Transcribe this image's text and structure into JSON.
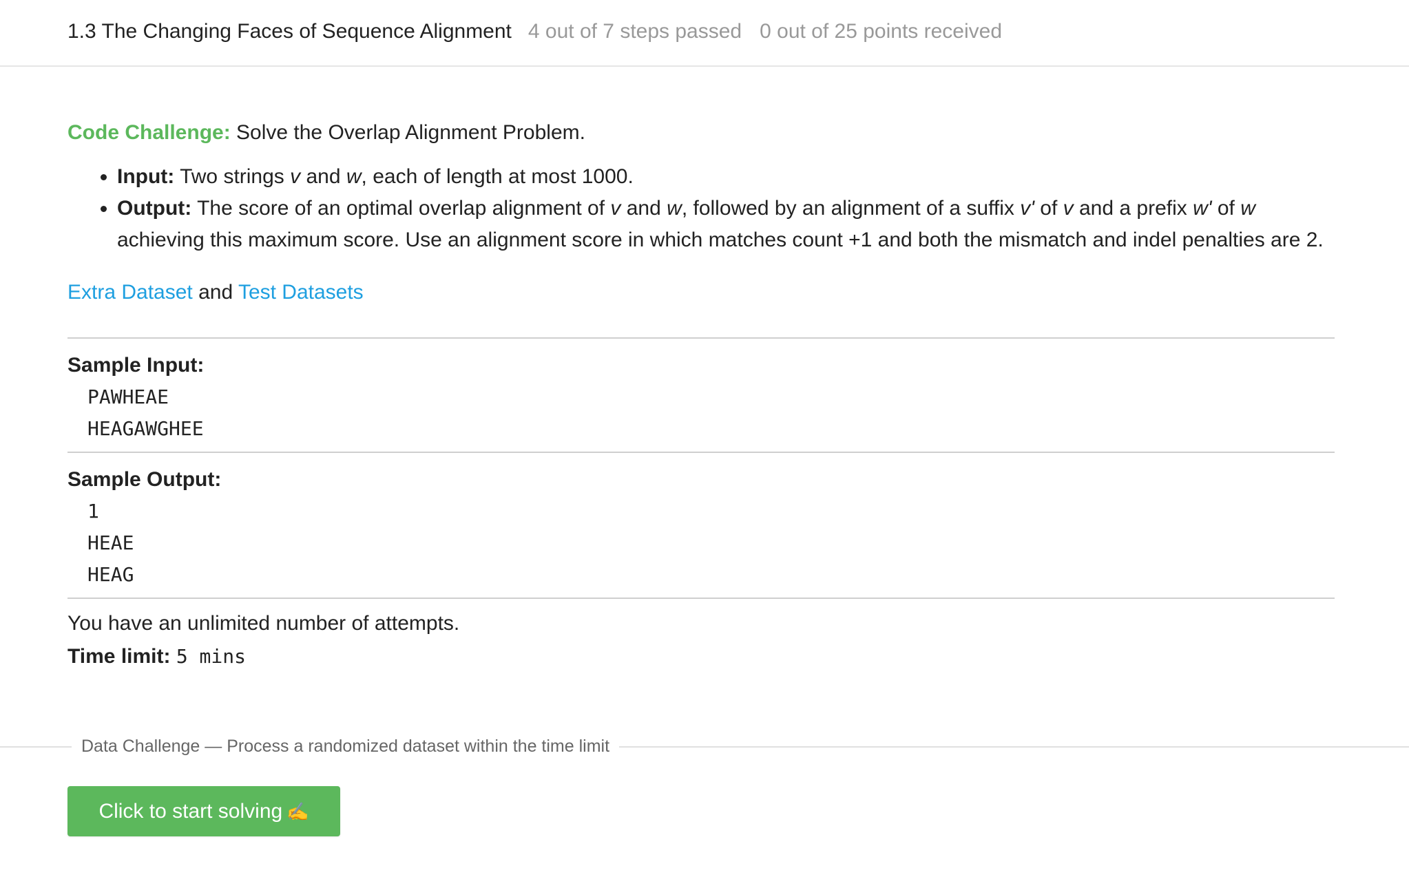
{
  "header": {
    "lesson_title": "1.3 The Changing Faces of Sequence Alignment",
    "steps_passed": "4 out of 7 steps passed",
    "points_received": "0 out of 25 points  received"
  },
  "challenge": {
    "label": "Code Challenge:",
    "statement": " Solve the Overlap Alignment Problem.",
    "input": {
      "label": "Input:",
      "text_1": " Two strings ",
      "v": "v",
      "text_2": " and ",
      "w": "w",
      "text_3": ", each of length at most 1000."
    },
    "output": {
      "label": "Output:",
      "text_1": " The score of an optimal overlap alignment of ",
      "v": "v",
      "text_2": " and ",
      "w": "w",
      "text_3": ", followed by an alignment of a suffix ",
      "v_prime": "v'",
      "text_4": " of ",
      "v2": "v",
      "text_5": " and a prefix ",
      "w_prime": "w'",
      "text_6": " of ",
      "w2": "w",
      "text_7": " achieving this maximum score. Use an alignment score in which matches count +1 and both the mismatch and indel penalties are 2."
    },
    "links": {
      "extra_dataset": "Extra Dataset",
      "and": " and ",
      "test_datasets": "Test Datasets"
    }
  },
  "sample_input": {
    "title": "Sample Input:",
    "lines": [
      "PAWHEAE",
      "HEAGAWGHEE"
    ]
  },
  "sample_output": {
    "title": "Sample Output:",
    "lines": [
      "1",
      "HEAE",
      "HEAG"
    ]
  },
  "attempts_text": "You have an unlimited number of attempts.",
  "time_limit": {
    "label": "Time limit:",
    "value": "5 mins"
  },
  "data_challenge_label": "Data Challenge — Process a randomized dataset within the time limit",
  "start_button": {
    "label": "Click to start solving",
    "icon": "writing-hand-icon",
    "color": "#5cb85c"
  },
  "colors": {
    "accent_green": "#5cb85c",
    "link_blue": "#1e9fe0",
    "muted_gray": "#999999"
  }
}
